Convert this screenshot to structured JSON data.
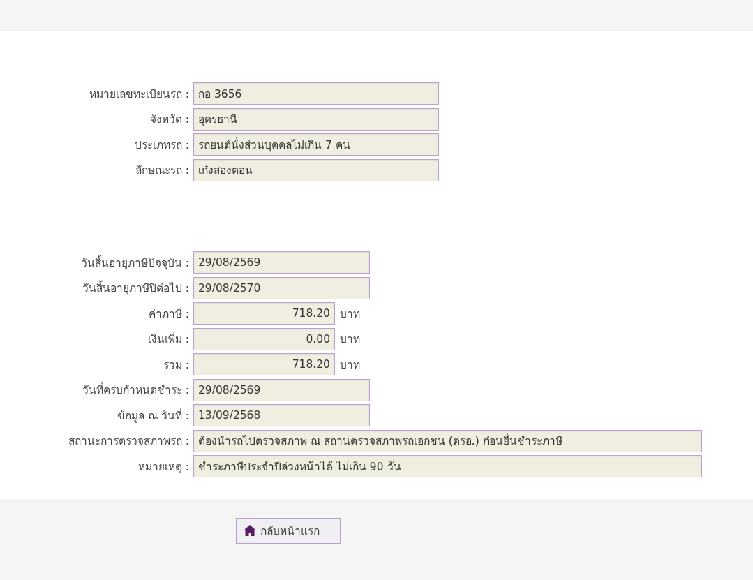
{
  "vehicle_section": [
    {
      "label": "หมายเลขทะเบียนรถ :",
      "value": "กอ 3656",
      "kind": "wide"
    },
    {
      "label": "จังหวัด :",
      "value": "อุดรธานี",
      "kind": "wide"
    },
    {
      "label": "ประเภทรถ :",
      "value": "รถยนต์นั่งส่วนบุคคลไม่เกิน 7 คน",
      "kind": "wide"
    },
    {
      "label": "ลักษณะรถ :",
      "value": "เก๋งสองตอน",
      "kind": "wide"
    }
  ],
  "tax_section": [
    {
      "label": "วันสิ้นอายุภาษีปัจจุบัน :",
      "value": "29/08/2569",
      "kind": "date"
    },
    {
      "label": "วันสิ้นอายุภาษีปีต่อไป :",
      "value": "29/08/2570",
      "kind": "date"
    },
    {
      "label": "ค่าภาษี :",
      "value": "718.20",
      "kind": "amount",
      "unit": "บาท"
    },
    {
      "label": "เงินเพิ่ม :",
      "value": "0.00",
      "kind": "amount",
      "unit": "บาท"
    },
    {
      "label": "รวม :",
      "value": "718.20",
      "kind": "amount",
      "unit": "บาท"
    },
    {
      "label": "วันที่ครบกำหนดชำระ :",
      "value": "29/08/2569",
      "kind": "date"
    },
    {
      "label": "ข้อมูล ณ วันที่ :",
      "value": "13/09/2568",
      "kind": "date"
    },
    {
      "label": "สถานะการตรวจสภาพรถ :",
      "value": "ต้องนำรถไปตรวจสภาพ ณ สถานตรวจสภาพรถเอกชน (ตรอ.) ก่อนยื่นชำระภาษี",
      "kind": "long"
    },
    {
      "label": "หมายเหตุ :",
      "value": "ชำระภาษีประจำปีล่วงหน้าได้ ไม่เกิน 90 วัน",
      "kind": "long"
    }
  ],
  "home_button": {
    "label": "กลับหน้าแรก"
  }
}
